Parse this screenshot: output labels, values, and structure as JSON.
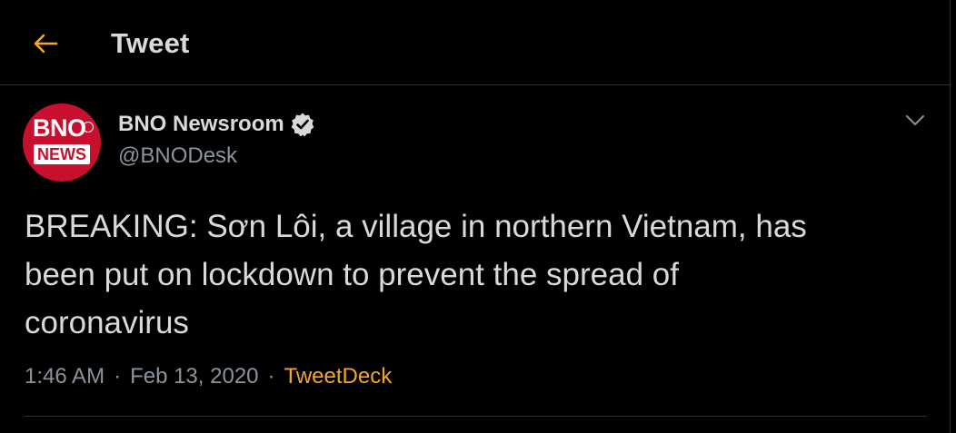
{
  "header": {
    "title": "Tweet",
    "back_icon": "arrow-left-icon"
  },
  "author": {
    "avatar_line1": "BNO",
    "avatar_line2": "NEWS",
    "display_name": "BNO Newsroom",
    "handle": "@BNODesk",
    "verified_icon": "verified-badge-icon"
  },
  "tweet": {
    "text": "BREAKING: Sơn Lôi, a village in northern Vietnam, has\nbeen put on lockdown to prevent the spread of\ncoronavirus",
    "time": "1:46 AM",
    "separator": "·",
    "date": "Feb 13, 2020",
    "source": "TweetDeck"
  },
  "menu": {
    "caret_icon": "chevron-down-icon"
  },
  "colors": {
    "background": "#000000",
    "text": "#d9d9d9",
    "secondary_text": "#8b949c",
    "accent": "#f5a623",
    "avatar_red": "#c8102e",
    "divider": "#2f3336"
  }
}
